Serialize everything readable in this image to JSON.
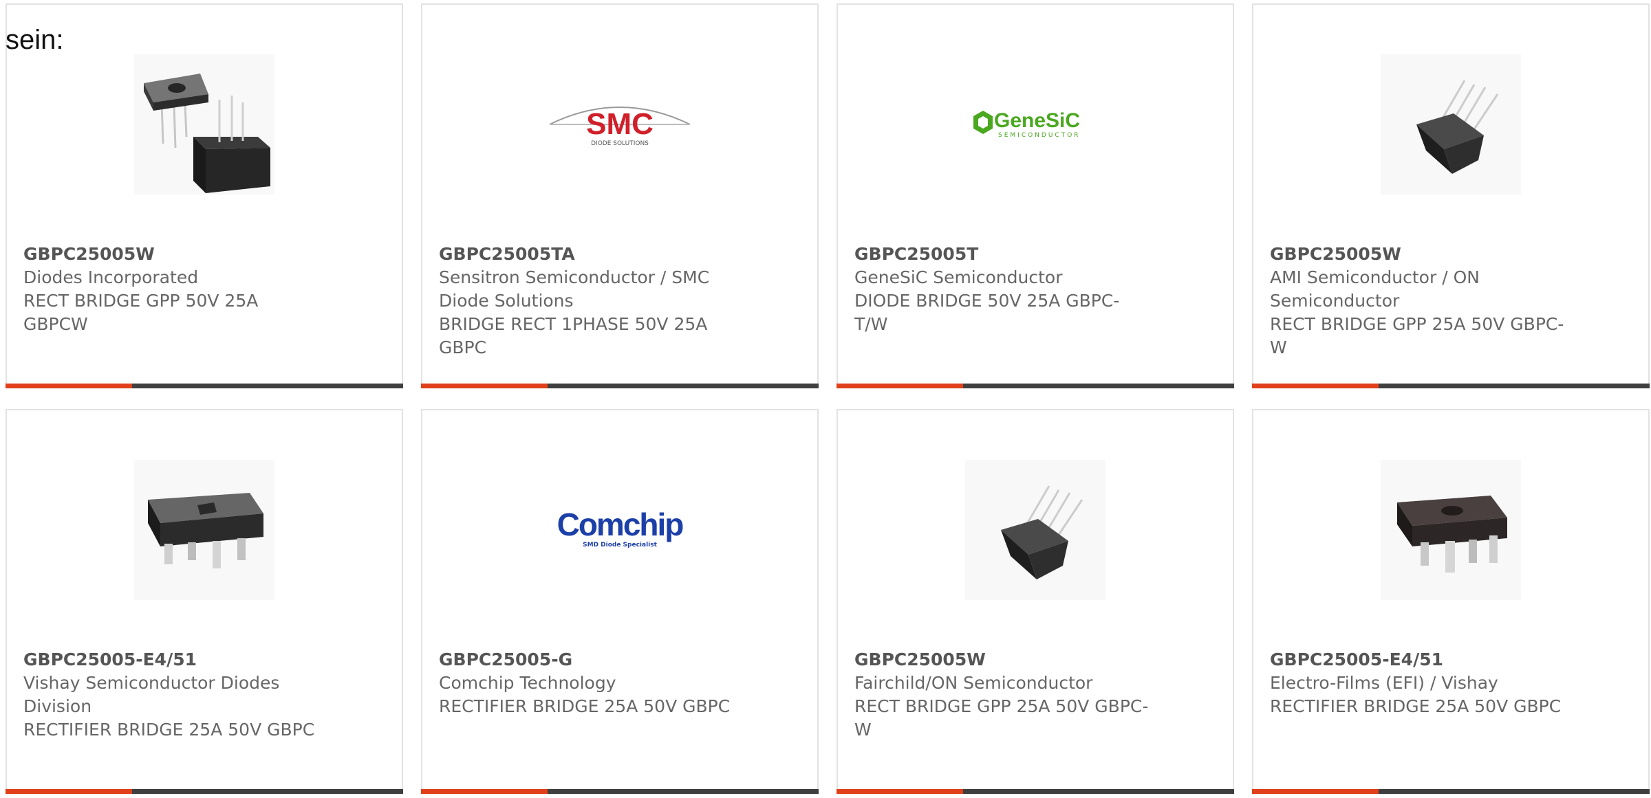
{
  "intro_text": "sein:",
  "products": [
    {
      "part_number": "GBPC25005W",
      "manufacturer": "Diodes Incorporated",
      "description": "RECT BRIDGE GPP 50V 25A GBPCW",
      "image": "bridge-rectifier-pair-photo"
    },
    {
      "part_number": "GBPC25005TA",
      "manufacturer": "Sensitron Semiconductor / SMC Diode Solutions",
      "description": "BRIDGE RECT 1PHASE 50V 25A GBPC",
      "image": "smc-logo",
      "logo": {
        "text": "SMC",
        "subtext": "DIODE SOLUTIONS",
        "color": "#d0202a"
      }
    },
    {
      "part_number": "GBPC25005T",
      "manufacturer": "GeneSiC Semiconductor",
      "description": "DIODE BRIDGE 50V 25A GBPC-T/W",
      "image": "genesic-logo",
      "logo": {
        "text": "GeneSiC",
        "subtext": "SEMICONDUCTOR",
        "color": "#4aa820"
      }
    },
    {
      "part_number": "GBPC25005W",
      "manufacturer": "AMI Semiconductor / ON Semiconductor",
      "description": "RECT BRIDGE GPP 25A 50V GBPC-W",
      "image": "bridge-rectifier-wire-leads-photo"
    },
    {
      "part_number": "GBPC25005-E4/51",
      "manufacturer": "Vishay Semiconductor Diodes Division",
      "description": "RECTIFIER BRIDGE 25A 50V GBPC",
      "image": "bridge-rectifier-tab-leads-photo"
    },
    {
      "part_number": "GBPC25005-G",
      "manufacturer": "Comchip Technology",
      "description": "RECTIFIER BRIDGE 25A 50V GBPC",
      "image": "comchip-logo",
      "logo": {
        "text": "Comchip",
        "subtext": "SMD Diode Specialist",
        "color": "#1c3fa8"
      }
    },
    {
      "part_number": "GBPC25005W",
      "manufacturer": "Fairchild/ON Semiconductor",
      "description": "RECT BRIDGE GPP 25A 50V GBPC-W",
      "image": "bridge-rectifier-wire-leads-photo"
    },
    {
      "part_number": "GBPC25005-E4/51",
      "manufacturer": "Electro-Films (EFI) / Vishay",
      "description": "RECTIFIER BRIDGE 25A 50V GBPC",
      "image": "bridge-rectifier-tab-leads-photo"
    }
  ],
  "colors": {
    "accent": "#e0401a",
    "bar": "#3f3f3f",
    "text": "#666666",
    "border": "#e2e2e2"
  }
}
